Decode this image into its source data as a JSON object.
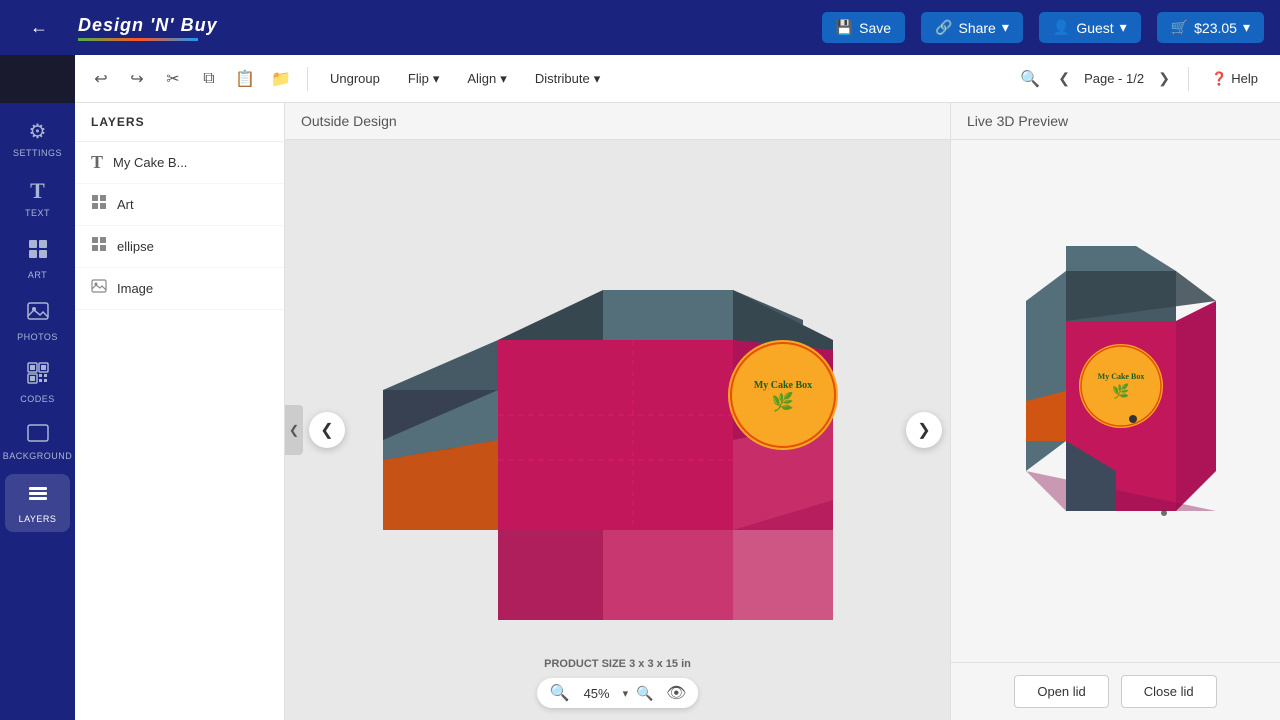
{
  "topbar": {
    "logo": "Design 'N' Buy",
    "back_label": "←",
    "save_label": "Save",
    "share_label": "Share",
    "guest_label": "Guest",
    "cart_label": "$23.05"
  },
  "toolbar": {
    "ungroup_label": "Ungroup",
    "flip_label": "Flip",
    "align_label": "Align",
    "distribute_label": "Distribute",
    "page_label": "Page - 1/2",
    "help_label": "Help"
  },
  "sidebar": {
    "items": [
      {
        "id": "settings",
        "label": "SETTINGS",
        "icon": "⚙"
      },
      {
        "id": "text",
        "label": "TEXT",
        "icon": "T"
      },
      {
        "id": "art",
        "label": "ART",
        "icon": "✦"
      },
      {
        "id": "photos",
        "label": "PHOTOS",
        "icon": "🖼"
      },
      {
        "id": "codes",
        "label": "CODES",
        "icon": "⊞"
      },
      {
        "id": "background",
        "label": "BACKGROUND",
        "icon": "▭"
      },
      {
        "id": "layers",
        "label": "LAYERS",
        "icon": "≡",
        "active": true
      }
    ]
  },
  "layers": {
    "header": "LAYERS",
    "items": [
      {
        "id": "cake-b",
        "label": "My Cake B...",
        "icon": "T"
      },
      {
        "id": "art",
        "label": "Art",
        "icon": "⊞"
      },
      {
        "id": "ellipse",
        "label": "ellipse",
        "icon": "⊞"
      },
      {
        "id": "image",
        "label": "Image",
        "icon": "🖼"
      }
    ]
  },
  "canvas": {
    "label": "Outside Design",
    "zoom_value": "45%",
    "product_size": "PRODUCT SIZE",
    "product_dimensions": "3 x 3 x 15 in"
  },
  "preview": {
    "label": "Live 3D Preview",
    "open_lid_label": "Open lid",
    "close_lid_label": "Close lid"
  }
}
